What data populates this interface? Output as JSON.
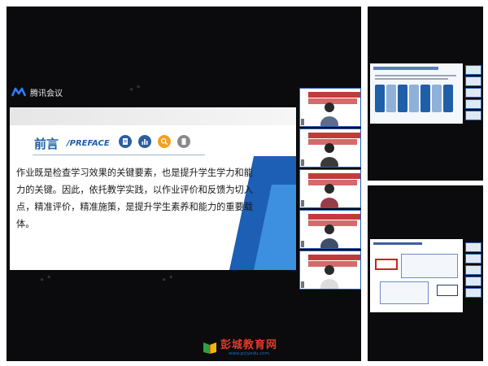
{
  "app": {
    "name": "腾讯会议"
  },
  "slide": {
    "title": "前言",
    "subtitle": "/PREFACE",
    "body": "作业既是检查学习效果的关键要素，也是提升学生学力和能力的关键。因此，依托教学实践，以作业评价和反馈为切入点，精准评价，精准施策，是提升学生素养和能力的重要载体。",
    "icons": [
      "document-icon",
      "bar-chart-icon",
      "search-icon",
      "notebook-icon"
    ]
  },
  "colors": {
    "accent": "#1f5fa8",
    "window_bg": "#0b0b0d",
    "logo_red": "#e03a2a",
    "logo_blue": "#1f6fc4"
  },
  "site": {
    "name": "彭城教育网",
    "url": "www.pcjyedu.com"
  }
}
